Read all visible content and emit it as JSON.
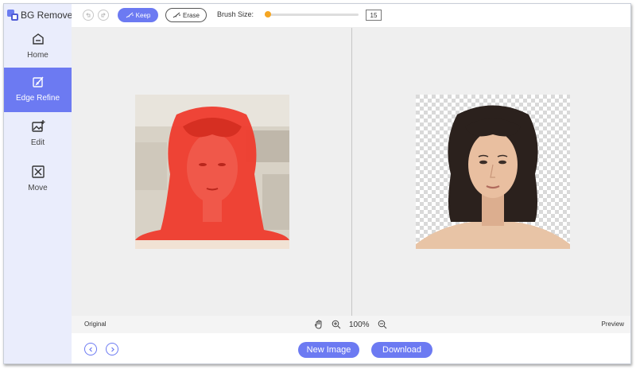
{
  "app": {
    "title": "BG Remover"
  },
  "sidebar": {
    "items": [
      {
        "label": "Home",
        "icon": "home-icon"
      },
      {
        "label": "Edge Refine",
        "icon": "edge-refine-icon",
        "active": true
      },
      {
        "label": "Edit",
        "icon": "edit-image-icon"
      },
      {
        "label": "Move",
        "icon": "move-icon"
      }
    ]
  },
  "toolbar": {
    "keep_label": "Keep",
    "erase_label": "Erase",
    "brush_size_label": "Brush Size:",
    "brush_size_value": "15",
    "brush_slider_fraction": 0.03
  },
  "infobar": {
    "original_label": "Original",
    "preview_label": "Preview",
    "zoom_level": "100%"
  },
  "footer": {
    "new_image_label": "New Image",
    "download_label": "Download"
  },
  "colors": {
    "accent": "#6c7af2",
    "sidebar_bg": "#eaedfc",
    "slider": "#f5a623",
    "keep_overlay": "#ef3b2d"
  }
}
